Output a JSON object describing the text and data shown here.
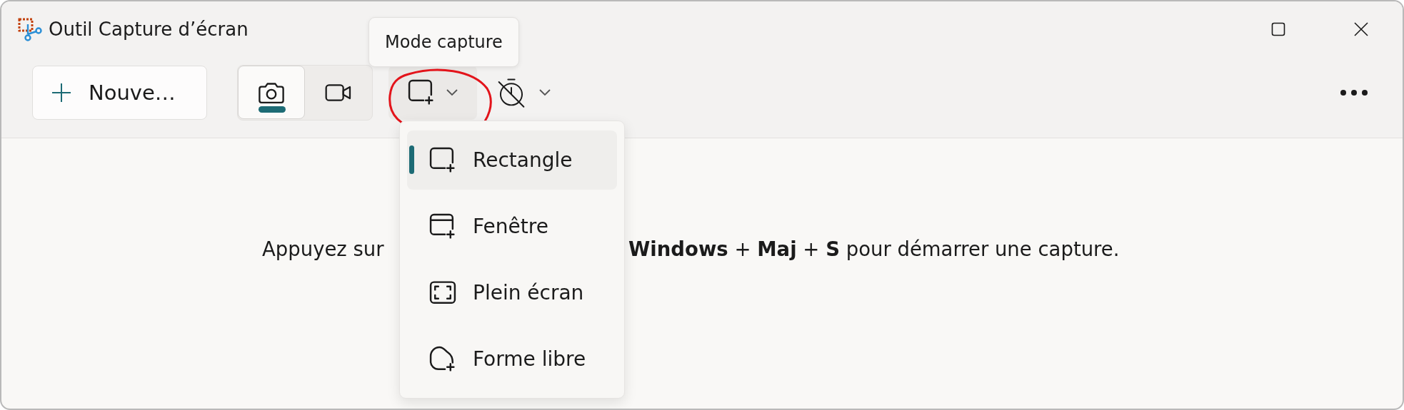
{
  "window": {
    "title": "Outil Capture d’écran"
  },
  "toolbar": {
    "new_button": "Nouve…",
    "capture_types": [
      {
        "kind": "photo",
        "selected": true
      },
      {
        "kind": "video",
        "selected": false
      }
    ],
    "mode_tooltip": "Mode capture"
  },
  "mode_menu": [
    {
      "kind": "rectangle",
      "label": "Rectangle",
      "selected": true
    },
    {
      "kind": "window",
      "label": "Fenêtre",
      "selected": false
    },
    {
      "kind": "fullscreen",
      "label": "Plein écran",
      "selected": false
    },
    {
      "kind": "freeform",
      "label": "Forme libre",
      "selected": false
    }
  ],
  "hint": {
    "before": "Appuyez sur",
    "after": "**Windows** + **Maj** + **S** pour démarrer une capture."
  }
}
